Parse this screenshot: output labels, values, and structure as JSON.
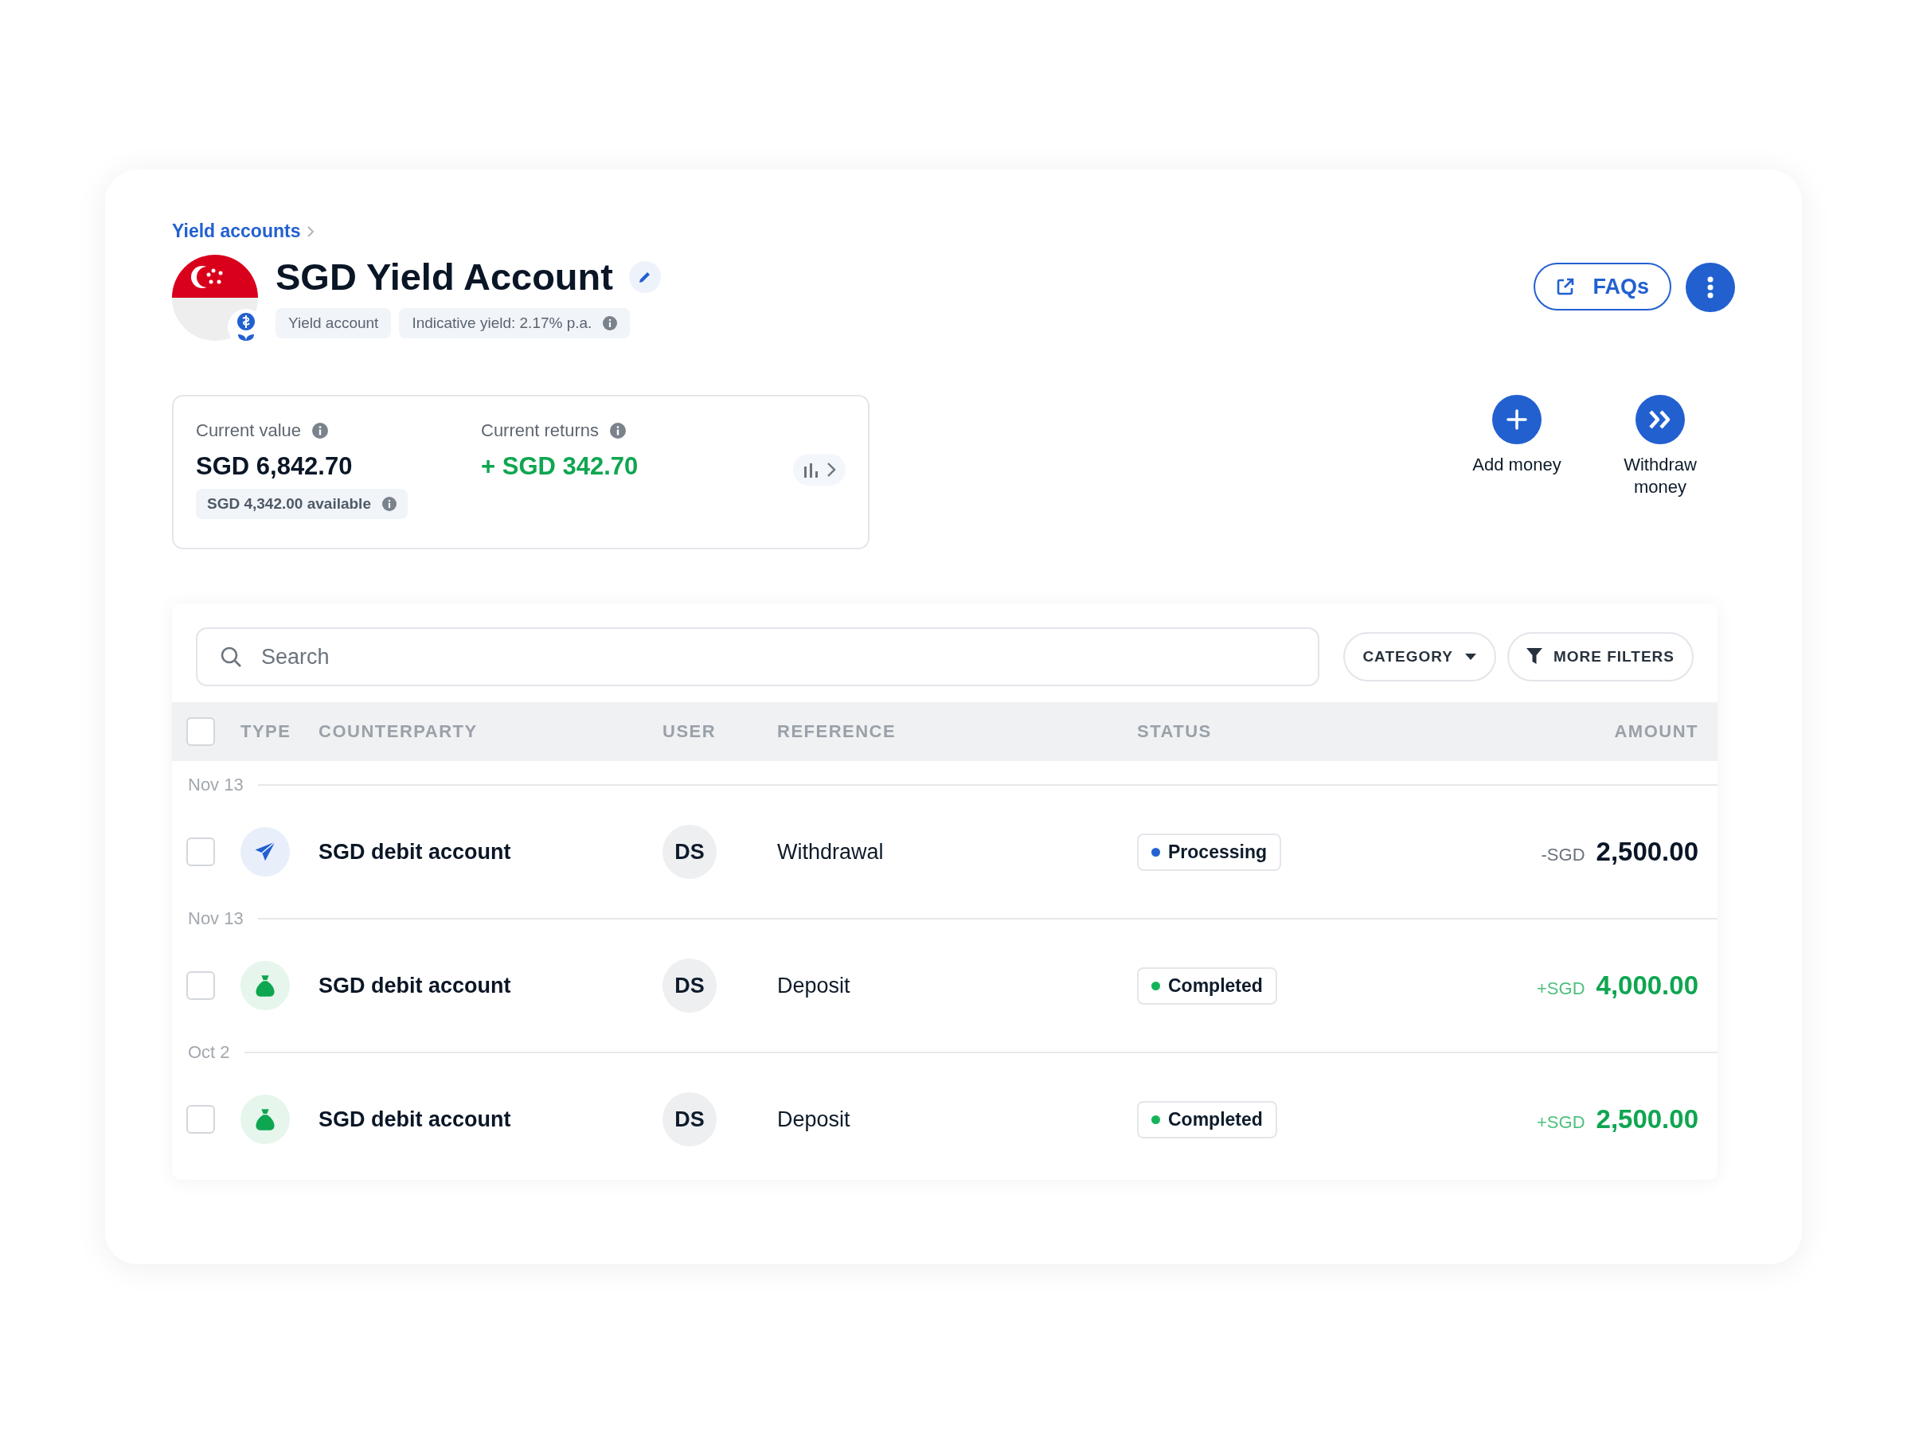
{
  "breadcrumb": {
    "label": "Yield accounts"
  },
  "account": {
    "title": "SGD Yield Account",
    "tags": [
      {
        "kind": "type",
        "label": "Yield account"
      },
      {
        "kind": "yield",
        "label": "Indicative yield: 2.17% p.a."
      }
    ]
  },
  "header_actions": {
    "faqs": "FAQs"
  },
  "summary": {
    "current_value": {
      "label": "Current value",
      "amount": "SGD 6,842.70",
      "available": "SGD 4,342.00 available"
    },
    "current_returns": {
      "label": "Current returns",
      "amount": "+ SGD 342.70"
    }
  },
  "quick_actions": [
    {
      "kind": "add",
      "label": "Add money"
    },
    {
      "kind": "withdraw",
      "label": "Withdraw money"
    }
  ],
  "search": {
    "placeholder": "Search"
  },
  "filters": [
    {
      "kind": "dropdown",
      "label": "CATEGORY"
    },
    {
      "kind": "filter",
      "label": "MORE FILTERS"
    }
  ],
  "table": {
    "select_all": {
      "checked": false
    },
    "columns": [
      "TYPE",
      "COUNTERPARTY",
      "USER",
      "REFERENCE",
      "STATUS",
      "AMOUNT"
    ],
    "groups": [
      {
        "date": "Nov 13",
        "rows": [
          {
            "kind": "withdrawal",
            "checked": false,
            "counterparty": "SGD debit account",
            "user": "DS",
            "reference": "Withdrawal",
            "status": "Processing",
            "color": "#2563d0",
            "sign": "-SGD",
            "amount": "2,500.00"
          }
        ]
      },
      {
        "date": "Nov 13",
        "rows": [
          {
            "kind": "deposit",
            "checked": false,
            "counterparty": "SGD debit account",
            "user": "DS",
            "reference": "Deposit",
            "status": "Completed",
            "color": "#16b45a",
            "sign": "+SGD",
            "amount": "4,000.00"
          }
        ]
      },
      {
        "date": "Oct 2",
        "rows": [
          {
            "kind": "deposit",
            "checked": false,
            "counterparty": "SGD debit account",
            "user": "DS",
            "reference": "Deposit",
            "status": "Completed",
            "color": "#16b45a",
            "sign": "+SGD",
            "amount": "2,500.00"
          }
        ]
      }
    ]
  }
}
